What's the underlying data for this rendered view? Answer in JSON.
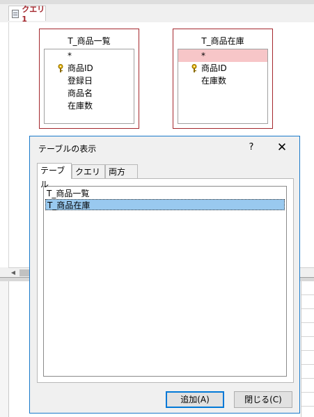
{
  "document_tab": {
    "label": "クエリ1"
  },
  "tables": [
    {
      "title": "T_商品一覧",
      "fields": [
        "*",
        "商品ID",
        "登録日",
        "商品名",
        "在庫数"
      ],
      "key_field_index": 1,
      "selected_index": -1
    },
    {
      "title": "T_商品在庫",
      "fields": [
        "*",
        "商品ID",
        "在庫数"
      ],
      "key_field_index": 1,
      "selected_index": 0
    }
  ],
  "dialog": {
    "title": "テーブルの表示",
    "help_label": "?",
    "close_label": "✕",
    "tabs": [
      "テーブル",
      "クエリ",
      "両方"
    ],
    "active_tab": 0,
    "list_items": [
      "T_商品一覧",
      "T_商品在庫"
    ],
    "selected_item": 1,
    "add_button": "追加(A)",
    "close_button": "閉じる(C)"
  },
  "colors": {
    "accent": "#a4262c",
    "selection": "#99c9ef",
    "field_highlight": "#f7c6c8",
    "dialog_border": "#1979ca"
  }
}
